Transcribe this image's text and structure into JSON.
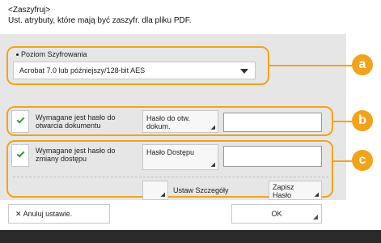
{
  "header": {
    "title": "<Zaszyfruj>",
    "subtitle": "Ust. atrybuty, które mają być zaszyfr. dla pliku PDF."
  },
  "encryption_level": {
    "label": "Poziom Szyfrowania",
    "selected_value": "Acrobat 7.0 lub późniejszy/128-bit AES"
  },
  "open_password": {
    "checkbox_label_line1": "Wymagane jest hasło do",
    "checkbox_label_line2": "otwarcia dokumentu",
    "checked": true,
    "button_line1": "Hasło do otw.",
    "button_line2": "dokum.",
    "value": ""
  },
  "access_password": {
    "checkbox_label_line1": "Wymagane jest hasło do",
    "checkbox_label_line2": "zmiany dostępu",
    "checked": true,
    "button_label": "Hasło Dostępu",
    "value": ""
  },
  "details": {
    "label": "Ustaw Szczegóły",
    "save_button_line1": "Zapisz",
    "save_button_line2": "Hasło"
  },
  "callouts": [
    "a",
    "b",
    "c"
  ],
  "footer": {
    "cancel_label": "Anuluj ustawie.",
    "cancel_icon": "close-icon",
    "ok_label": "OK"
  },
  "colors": {
    "highlight": "#f2a31b",
    "check": "#3a9c3a",
    "panel": "#e6e6e6"
  }
}
